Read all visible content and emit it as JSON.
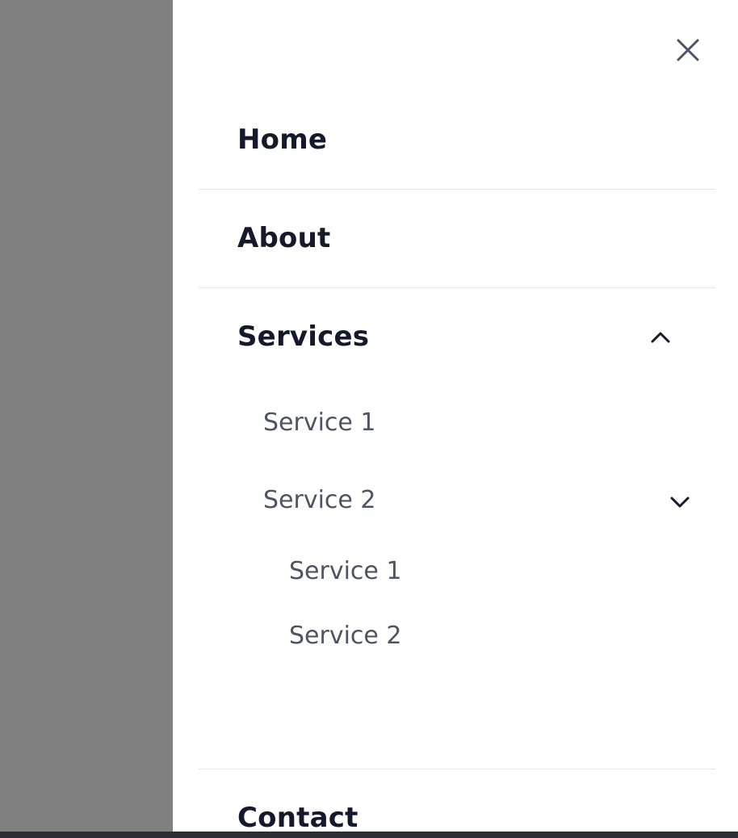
{
  "overlay": {
    "color": "#808080"
  },
  "drawer": {
    "close_icon": "close-icon",
    "menu": {
      "home": {
        "label": "Home"
      },
      "about": {
        "label": "About"
      },
      "services": {
        "label": "Services",
        "expanded": true,
        "icon": "chevron-up-icon",
        "children": [
          {
            "label": "Service 1"
          },
          {
            "label": "Service 2",
            "icon": "chevron-down-icon",
            "children": [
              {
                "label": "Service 1"
              },
              {
                "label": "Service 2"
              }
            ]
          }
        ]
      },
      "contact": {
        "label": "Contact"
      }
    }
  },
  "colors": {
    "text_primary": "#141a2b",
    "text_secondary": "#4b5563",
    "divider": "#e5e7eb",
    "overlay": "#808080",
    "drawer_bg": "#ffffff"
  }
}
